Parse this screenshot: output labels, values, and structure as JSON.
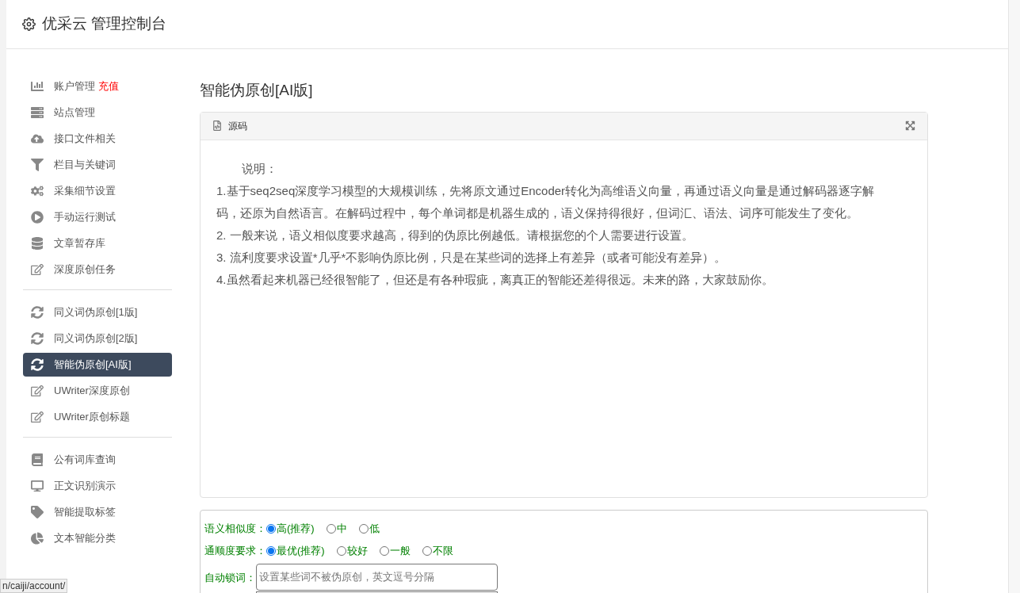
{
  "header": {
    "title": "优采云 管理控制台"
  },
  "sidebar": {
    "groups": [
      {
        "items": [
          {
            "kind": "chart",
            "label": "账户管理",
            "badge": "充值",
            "selected": false
          },
          {
            "kind": "server",
            "label": "站点管理",
            "selected": false
          },
          {
            "kind": "cloud",
            "label": "接口文件相关",
            "selected": false
          },
          {
            "kind": "filter",
            "label": "栏目与关键词",
            "selected": false
          },
          {
            "kind": "gears",
            "label": "采集细节设置",
            "selected": false
          },
          {
            "kind": "play",
            "label": "手动运行测试",
            "selected": false
          },
          {
            "kind": "database",
            "label": "文章暂存库",
            "selected": false
          },
          {
            "kind": "edit",
            "label": "深度原创任务",
            "selected": false
          }
        ]
      },
      {
        "items": [
          {
            "kind": "refresh",
            "label": "同义词伪原创[1版]",
            "selected": false
          },
          {
            "kind": "refresh",
            "label": "同义词伪原创[2版]",
            "selected": false
          },
          {
            "kind": "refresh",
            "label": "智能伪原创[AI版]",
            "selected": true
          },
          {
            "kind": "edit",
            "label": "UWriter深度原创",
            "selected": false
          },
          {
            "kind": "edit",
            "label": "UWriter原创标题",
            "selected": false
          }
        ]
      },
      {
        "items": [
          {
            "kind": "book",
            "label": "公有词库查询",
            "selected": false
          },
          {
            "kind": "desktop",
            "label": "正文识别演示",
            "selected": false
          },
          {
            "kind": "tag",
            "label": "智能提取标签",
            "selected": false
          },
          {
            "kind": "pie",
            "label": "文本智能分类",
            "selected": false
          }
        ]
      }
    ]
  },
  "page_title": "智能伪原创[AI版]",
  "editor": {
    "tab": "源码",
    "lines": [
      "说明：",
      "1.基于seq2seq深度学习模型的大规模训练，先将原文通过Encoder转化为高维语义向量，再通过语义向量是通过解码器逐字解码，还原为自然语言。在解码过程中，每个单词都是机器生成的，语义保持得很好，但词汇、语法、词序可能发生了变化。",
      "2. 一般来说，语义相似度要求越高，得到的伪原比例越低。请根据您的个人需要进行设置。",
      "3. 流利度要求设置*几乎*不影响伪原比例，只是在某些词的选择上有差异（或者可能没有差异）。",
      "4.虽然看起来机器已经很智能了，但还是有各种瑕疵，离真正的智能还差得很远。未来的路，大家鼓励你。"
    ]
  },
  "options": [
    {
      "label": "语义相似度：",
      "choices": [
        {
          "label": "高(推荐)",
          "selected": true
        },
        {
          "label": "中",
          "selected": false
        },
        {
          "label": "低",
          "selected": false
        }
      ]
    },
    {
      "label": "通顺度要求：",
      "choices": [
        {
          "label": "最优(推荐)",
          "selected": true
        },
        {
          "label": "较好",
          "selected": false
        },
        {
          "label": "一般",
          "selected": false
        },
        {
          "label": "不限",
          "selected": false
        }
      ]
    }
  ],
  "lock_words": {
    "label": "自动锁词：",
    "placeholder": "设置某些词不被伪原创，英文逗号分隔"
  },
  "status_bar": {
    "url": "n/caiji/account/"
  }
}
